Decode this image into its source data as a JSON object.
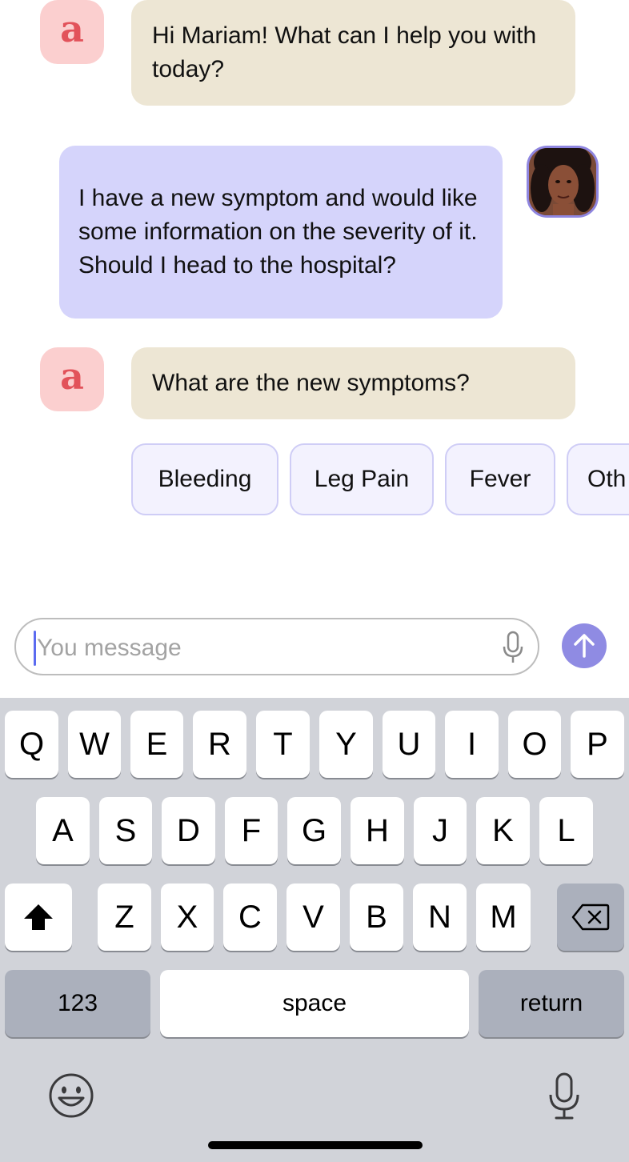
{
  "chat": {
    "bot_avatar_letter": "a",
    "messages": [
      {
        "from": "bot",
        "text": "Hi Mariam! What can I help you with today?"
      },
      {
        "from": "user",
        "text": "I have a new symptom and would like some information on the severity of it. Should I head to the hospital?"
      },
      {
        "from": "bot",
        "text": "What are the new symptoms?"
      }
    ],
    "quick_replies": [
      "Bleeding",
      "Leg Pain",
      "Fever",
      "Oth"
    ]
  },
  "composer": {
    "placeholder": "You message",
    "mic_icon": "microphone-icon",
    "send_icon": "arrow-up-icon"
  },
  "keyboard": {
    "row1": [
      "Q",
      "W",
      "E",
      "R",
      "T",
      "Y",
      "U",
      "I",
      "O",
      "P"
    ],
    "row2": [
      "A",
      "S",
      "D",
      "F",
      "G",
      "H",
      "J",
      "K",
      "L"
    ],
    "row3": [
      "Z",
      "X",
      "C",
      "V",
      "B",
      "N",
      "M"
    ],
    "numbers_label": "123",
    "space_label": "space",
    "return_label": "return",
    "shift_icon": "shift-icon",
    "delete_icon": "delete-icon",
    "emoji_icon": "emoji-icon",
    "dictation_icon": "microphone-icon"
  },
  "colors": {
    "bot_bubble": "#ede6d4",
    "user_bubble": "#d5d4fb",
    "chip_bg": "#f3f2fe",
    "accent": "#8f8be3",
    "bot_avatar_bg": "#fbcfcf",
    "bot_avatar_letter": "#e2525a"
  }
}
